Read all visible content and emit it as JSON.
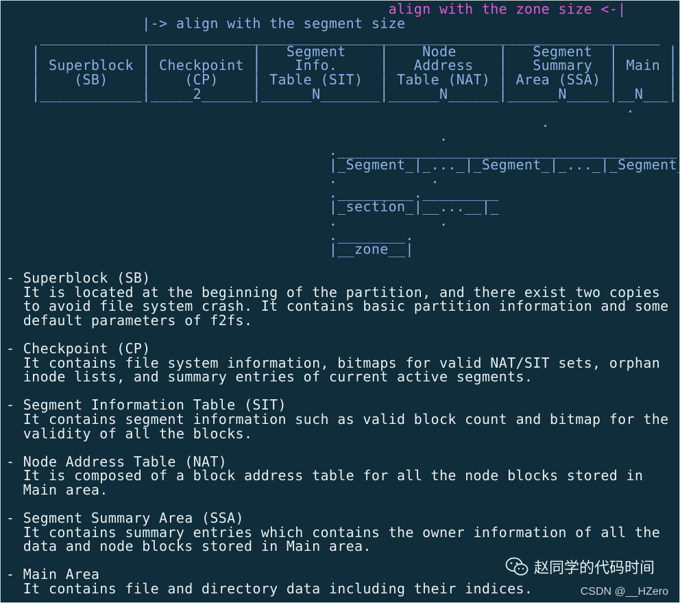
{
  "diagram": {
    "line1": "                                             align with the zone size <-|",
    "line2": "                |-> align with the segment size",
    "line3": "    _________________________________________________________________________",
    "line4": "   |            |            |   Segment    |    Node     |   Segment  |      |",
    "line5": "   | Superblock | Checkpoint |    Info.     |   Address   |   Summary  | Main |",
    "line6": "   |    (SB)    |    (CP)    | Table (SIT)  | Table (NAT) | Area (SSA) |      |",
    "line7": "   |____________|_____2______|______N_______|______N______|______N_____|__N___|",
    "line8": "                                                                         .      .",
    "line9": "                                                               .                .",
    "line10": "                                                   .                            .",
    "line11": "                                      .________________________________________.",
    "line12": "                                      |_Segment_|_..._|_Segment_|_..._|_Segment_|",
    "line13": "                                      .           .",
    "line14": "                                      ._________._________",
    "line15": "                                      |_section_|__...__|_",
    "line16": "                                      .            .",
    "line17": "                                      .________.",
    "line18": "                                      |__zone__|"
  },
  "descriptions": [
    {
      "title": "- Superblock (SB)",
      "lines": [
        "  It is located at the beginning of the partition, and there exist two copies",
        "  to avoid file system crash. It contains basic partition information and some",
        "  default parameters of f2fs."
      ]
    },
    {
      "title": "- Checkpoint (CP)",
      "lines": [
        "  It contains file system information, bitmaps for valid NAT/SIT sets, orphan",
        "  inode lists, and summary entries of current active segments."
      ]
    },
    {
      "title": "- Segment Information Table (SIT)",
      "lines": [
        "  It contains segment information such as valid block count and bitmap for the",
        "  validity of all the blocks."
      ]
    },
    {
      "title": "- Node Address Table (NAT)",
      "lines": [
        "  It is composed of a block address table for all the node blocks stored in",
        "  Main area."
      ]
    },
    {
      "title": "- Segment Summary Area (SSA)",
      "lines": [
        "  It contains summary entries which contains the owner information of all the",
        "  data and node blocks stored in Main area."
      ]
    },
    {
      "title": "- Main Area",
      "lines": [
        "  It contains file and directory data including their indices."
      ]
    }
  ],
  "watermark": {
    "text": "赵同学的代码时间",
    "icon": "wechat-icon"
  },
  "credit": "CSDN @__HZero"
}
